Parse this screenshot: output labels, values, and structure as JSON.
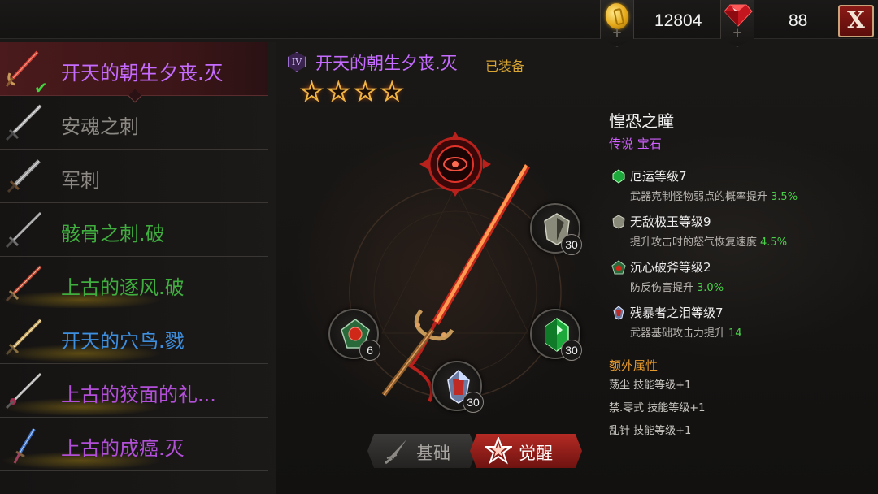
{
  "currency": {
    "gold": "12804",
    "gems": "88",
    "plus_glyph": "+",
    "gold_icon": "gold-coin-icon",
    "gem_icon": "red-gem-icon"
  },
  "close_label": "X",
  "weapon_list": [
    {
      "name": "开天的朝生夕丧.灭",
      "color": "#c56bff",
      "selected": true
    },
    {
      "name": "安魂之刺",
      "color": "#8c8984"
    },
    {
      "name": "军刺",
      "color": "#8c8984"
    },
    {
      "name": "骸骨之刺.破",
      "color": "#3fae3f"
    },
    {
      "name": "上古的逐风.破",
      "color": "#3fae3f"
    },
    {
      "name": "开天的穴鸟.戮",
      "color": "#3d8fe0"
    },
    {
      "name": "上古的狡面的礼...",
      "color": "#b24fd8"
    },
    {
      "name": "上古的成癌.灭",
      "color": "#b24fd8"
    }
  ],
  "weapon": {
    "tier": "IV",
    "title": "开天的朝生夕丧.灭",
    "status": "已装备",
    "stars": 4,
    "star_glyph": "★"
  },
  "sockets": [
    {
      "level": "30",
      "icon": "shield-gem-icon"
    },
    {
      "level": "6",
      "icon": "ruby-gem-icon"
    },
    {
      "level": "30",
      "icon": "emerald-gem-icon"
    },
    {
      "level": "30",
      "icon": "crystal-gem-icon"
    }
  ],
  "tabs": {
    "basic": "基础",
    "awaken": "觉醒"
  },
  "gem_detail": {
    "name": "惶恐之瞳",
    "type": "传说 宝石",
    "attributes": [
      {
        "name": "厄运等级7",
        "desc": "武器克制怪物弱点的概率提升",
        "value": "3.5%",
        "icon": "green-gem-icon"
      },
      {
        "name": "无敌极玉等级9",
        "desc": "提升攻击时的怒气恢复速度",
        "value": "4.5%",
        "icon": "shield-gem-icon"
      },
      {
        "name": "沉心破斧等级2",
        "desc": "防反伤害提升",
        "value": "3.0%",
        "icon": "ruby-gem-icon"
      },
      {
        "name": "残暴者之泪等级7",
        "desc": "武器基础攻击力提升",
        "value": "14",
        "icon": "crystal-gem-icon"
      }
    ],
    "extra_title": "额外属性",
    "extras": [
      "荡尘 技能等级+1",
      "禁.零式 技能等级+1",
      "乱针 技能等级+1"
    ]
  }
}
